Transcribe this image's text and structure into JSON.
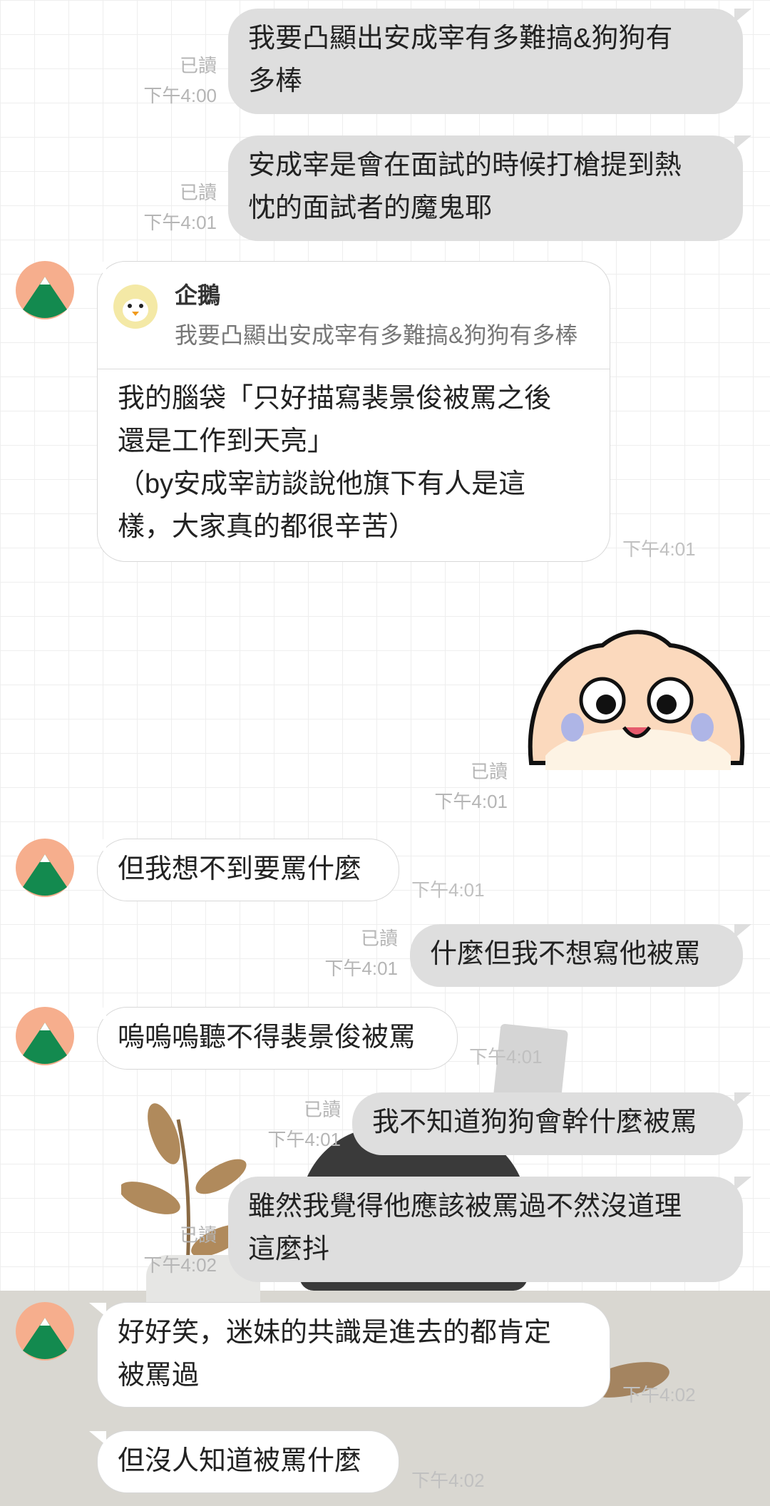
{
  "messages": {
    "m1": {
      "lines": [
        "我要凸顯出安成宰有多難搞&狗狗有",
        "多棒"
      ],
      "read": "已讀",
      "time": "下午4:00"
    },
    "m2": {
      "lines": [
        "安成宰是會在面試的時候打槍提到熱",
        "忱的面試者的魔鬼耶"
      ],
      "read": "已讀",
      "time": "下午4:01"
    },
    "reply": {
      "quoted_name": "企鵝",
      "quoted_text": "我要凸顯出安成宰有多難搞&狗狗有多棒",
      "lines": [
        "我的腦袋「只好描寫裴景俊被罵之後",
        "還是工作到天亮」",
        "（by安成宰訪談說他旗下有人是這",
        "樣，大家真的都很辛苦）"
      ],
      "time": "下午4:01"
    },
    "sticker": {
      "read": "已讀",
      "time": "下午4:01"
    },
    "m3": {
      "text": "但我想不到要罵什麼",
      "time": "下午4:01"
    },
    "m4": {
      "text": "什麼但我不想寫他被罵",
      "read": "已讀",
      "time": "下午4:01"
    },
    "m5": {
      "text": "嗚嗚嗚聽不得裴景俊被罵",
      "time": "下午4:01"
    },
    "m6": {
      "text": "我不知道狗狗會幹什麼被罵",
      "read": "已讀",
      "time": "下午4:01"
    },
    "m7": {
      "lines": [
        "雖然我覺得他應該被罵過不然沒道理",
        "這麼抖"
      ],
      "read": "已讀",
      "time": "下午4:02"
    },
    "m8": {
      "lines": [
        "好好笑，迷妹的共識是進去的都肯定",
        "被罵過"
      ],
      "time": "下午4:02"
    },
    "m9": {
      "text": "但沒人知道被罵什麼",
      "time": "下午4:02"
    }
  },
  "colors": {
    "outgoing_bubble": "#dedede",
    "incoming_bubble": "#ffffff",
    "avatar_bg": "#f6ae8d",
    "avatar_mountain": "#138a4f"
  }
}
